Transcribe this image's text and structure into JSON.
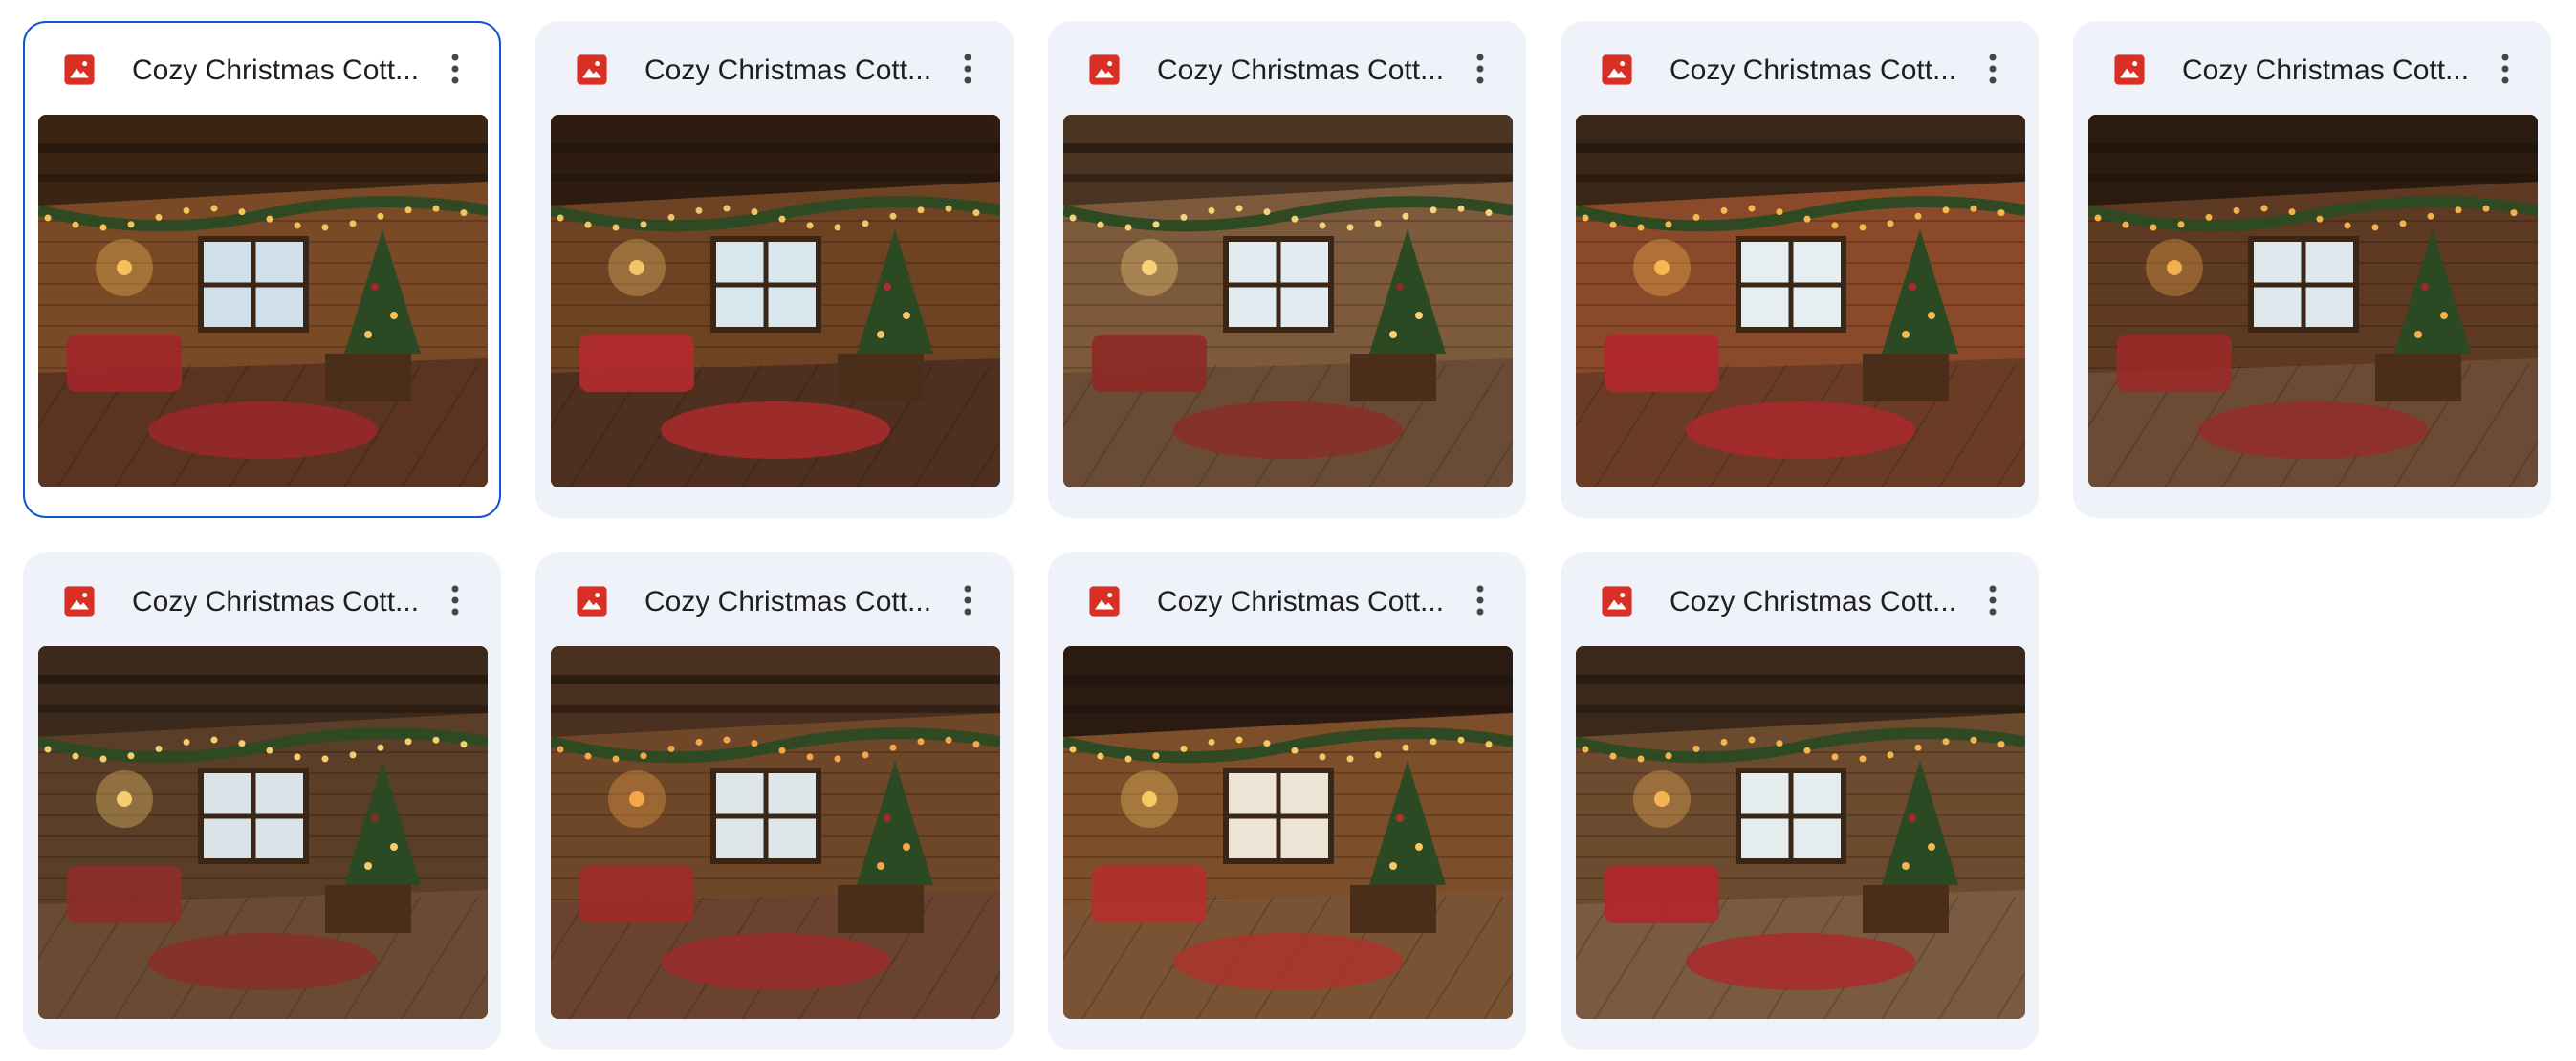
{
  "files": [
    {
      "name": "Cozy Christmas Cott...",
      "selected": true
    },
    {
      "name": "Cozy Christmas Cott...",
      "selected": false
    },
    {
      "name": "Cozy Christmas Cott...",
      "selected": false
    },
    {
      "name": "Cozy Christmas Cott...",
      "selected": false
    },
    {
      "name": "Cozy Christmas Cott...",
      "selected": false
    },
    {
      "name": "Cozy Christmas Cott...",
      "selected": false
    },
    {
      "name": "Cozy Christmas Cott...",
      "selected": false
    },
    {
      "name": "Cozy Christmas Cott...",
      "selected": false
    },
    {
      "name": "Cozy Christmas Cott...",
      "selected": false
    }
  ],
  "icons": {
    "file_type": "image-file-icon",
    "more": "more-vert-icon"
  },
  "colors": {
    "image_icon": "#d93025",
    "card_bg": "#eff3f9",
    "selected_border": "#0b57d0"
  }
}
